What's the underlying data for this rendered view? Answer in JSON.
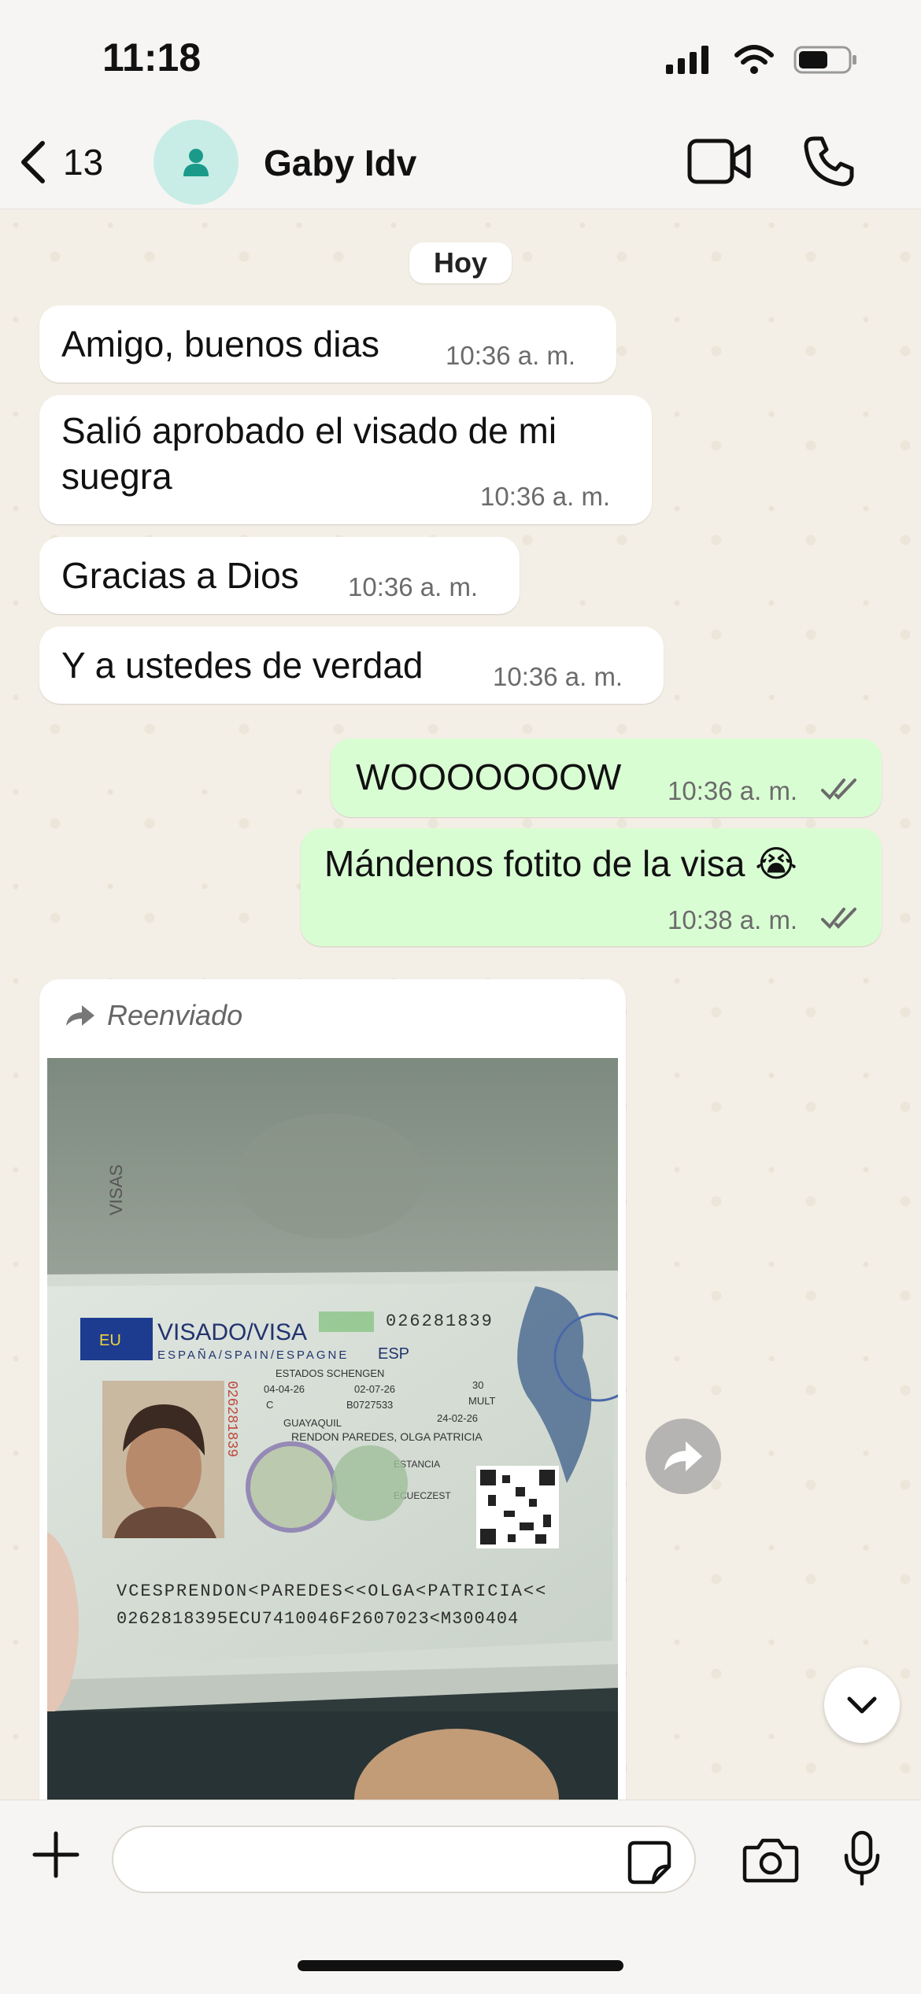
{
  "status_bar": {
    "time": "11:18"
  },
  "header": {
    "back_count": "13",
    "contact_name": "Gaby Idv"
  },
  "chat": {
    "date_chip": "Hoy",
    "messages": [
      {
        "direction": "incoming",
        "text": "Amigo, buenos dias",
        "time": "10:36 a. m."
      },
      {
        "direction": "incoming",
        "text": "Salió  aprobado el visado de mi suegra",
        "time": "10:36 a. m."
      },
      {
        "direction": "incoming",
        "text": "Gracias a Dios",
        "time": "10:36 a. m."
      },
      {
        "direction": "incoming",
        "text": "Y a ustedes de verdad",
        "time": "10:36 a. m."
      },
      {
        "direction": "outgoing",
        "text": "WOOOOOOOW",
        "time": "10:36 a. m.",
        "status": "read"
      },
      {
        "direction": "outgoing",
        "text": "Mándenos fotito de la visa 😭",
        "time": "10:38 a. m.",
        "status": "read"
      }
    ],
    "forwarded": {
      "label": "Reenviado",
      "photo": {
        "visa_title": "VISADO/VISA",
        "visa_subtitle": "ESPAÑA/SPAIN/ESPAGNE",
        "country_code": "ESP",
        "number": "026281839",
        "side_number": "026281839",
        "schengen": "ESTADOS SCHENGEN",
        "page_label": "VISAS",
        "date_from": "04-04-26",
        "date_to": "02-07-26",
        "days": "30",
        "entries": "MULT",
        "type": "C",
        "passport": "B0727533",
        "issue_date": "24-02-26",
        "place": "GUAYAQUIL",
        "holder": "RENDON PAREDES, OLGA PATRICIA",
        "field_estancia": "ESTANCIA",
        "nationality": "ECUECZEST",
        "mrz_line1": "VCESPRENDON<PAREDES<<OLGA<PATRICIA<<",
        "mrz_line2": "0262818395ECU7410046F2607023<M300404"
      }
    }
  },
  "input_bar": {
    "placeholder": ""
  },
  "colors": {
    "incoming_bubble": "#ffffff",
    "outgoing_bubble": "#d9fdd3",
    "avatar_bg": "#c8ede6",
    "avatar_icon": "#1b9a8a",
    "wallpaper": "#f4efe6",
    "read_ticks": "#6b6b6b"
  }
}
